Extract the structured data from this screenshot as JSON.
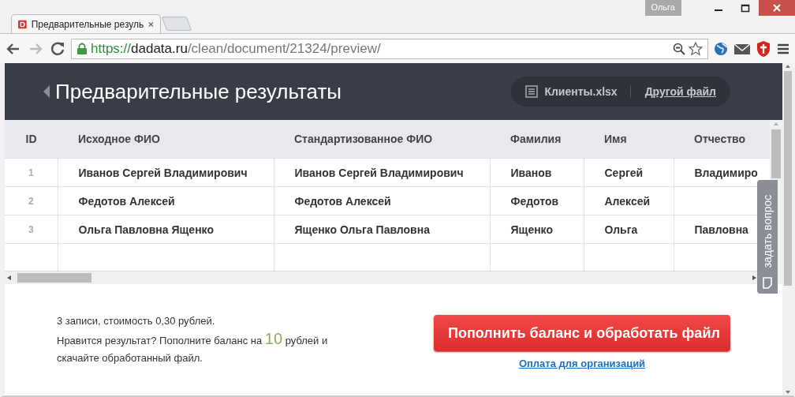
{
  "window": {
    "user": "Ольга"
  },
  "tabs": [
    {
      "title": "Предварительные резуль",
      "selected": true
    }
  ],
  "toolbar": {
    "back_disabled": false,
    "forward_disabled": true,
    "url": {
      "scheme": "https://",
      "host": "dadata.ru",
      "path": "/clean/document/21324/preview/"
    }
  },
  "header": {
    "title": "Предварительные результаты",
    "file_name": "Клиенты.xlsx",
    "other_file_link": "Другой файл"
  },
  "table": {
    "columns": [
      "ID",
      "Исходное ФИО",
      "Стандартизованное ФИО",
      "Фамилия",
      "Имя",
      "Отчество"
    ],
    "rows": [
      [
        "1",
        "Иванов Сергей Владимирович",
        "Иванов Сергей Владимирович",
        "Иванов",
        "Сергей",
        "Владимиро"
      ],
      [
        "2",
        "Федотов Алексей",
        "Федотов Алексей",
        "Федотов",
        "Алексей",
        ""
      ],
      [
        "3",
        "Ольга Павловна Ященко",
        "Ященко Ольга Павловна",
        "Ященко",
        "Ольга",
        "Павловна"
      ]
    ]
  },
  "footer": {
    "summary": "3 записи, стоимость 0,30 рублей.",
    "offer_before": "Нравится результат? Пополните баланс на",
    "offer_amount": "10",
    "offer_after": "рублей и скачайте обработанный файл.",
    "button": "Пополнить баланс и обработать файл",
    "org_link": "Оплата для организаций"
  },
  "feedback_tab": {
    "label": "задать вопрос"
  }
}
